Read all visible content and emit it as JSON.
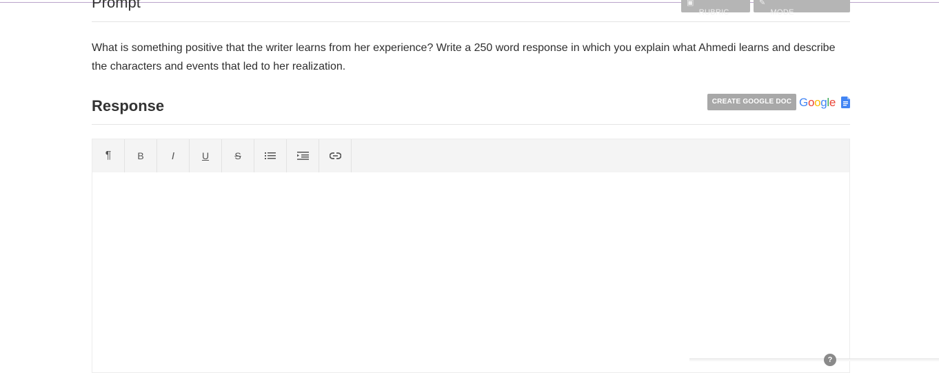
{
  "prompt": {
    "title": "Prompt",
    "view_rubric_label": "VIEW RUBRIC",
    "split_screen_label": "SPLIT SCREEN MODE",
    "text": "What is something positive that the writer learns from her experience? Write a 250 word response in which you explain what Ahmedi learns and describe the characters and events that led to her realization."
  },
  "response": {
    "title": "Response",
    "create_google_doc_label": "CREATE GOOGLE DOC",
    "google_logo_text": "Google"
  },
  "toolbar": {
    "tools": [
      {
        "name": "paragraph",
        "glyph": "¶"
      },
      {
        "name": "bold",
        "glyph": "B"
      },
      {
        "name": "italic",
        "glyph": "I"
      },
      {
        "name": "underline",
        "glyph": "U"
      },
      {
        "name": "strikethrough",
        "glyph": "S"
      },
      {
        "name": "bulleted-list",
        "icon": "list-icon"
      },
      {
        "name": "indent",
        "icon": "indent-icon"
      },
      {
        "name": "link",
        "icon": "link-icon"
      }
    ]
  },
  "help": {
    "glyph": "?"
  }
}
